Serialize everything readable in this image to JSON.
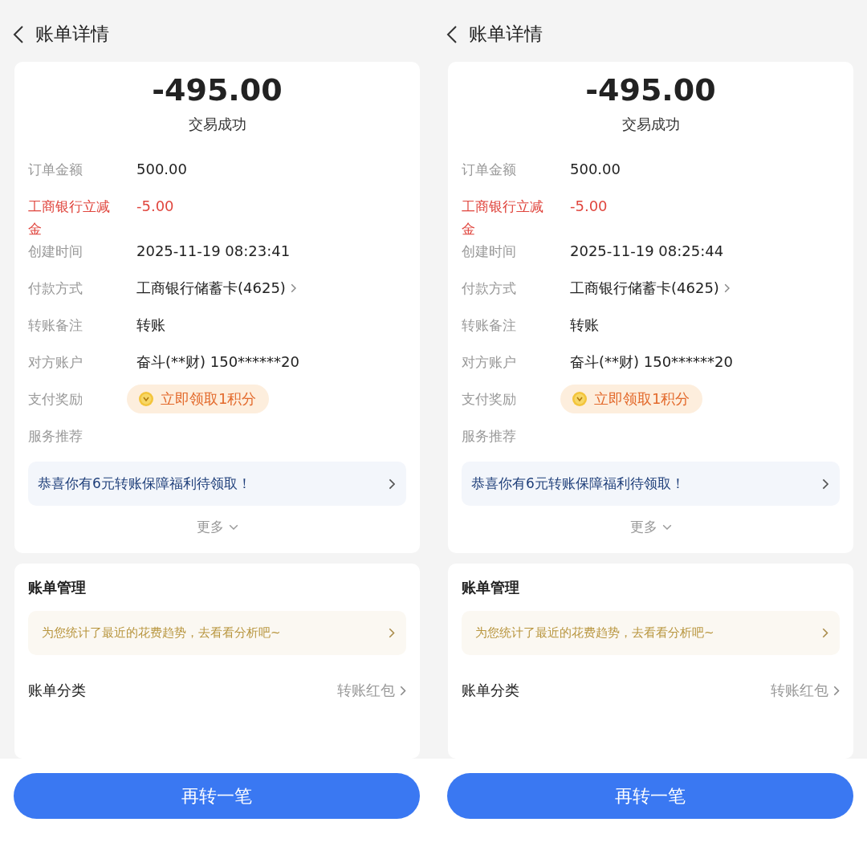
{
  "panels": [
    {
      "header": {
        "title": "账单详情"
      },
      "amount": "-495.00",
      "status": "交易成功",
      "rows": [
        {
          "kind": "plain",
          "label": "订单金额",
          "value": "500.00"
        },
        {
          "kind": "discount",
          "label": "工商银行立减金",
          "value": "-5.00"
        },
        {
          "kind": "plain",
          "label": "创建时间",
          "value": "2025-11-19 08:23:41"
        },
        {
          "kind": "link",
          "label": "付款方式",
          "value": "工商银行储蓄卡(4625)"
        },
        {
          "kind": "plain",
          "label": "转账备注",
          "value": "转账"
        },
        {
          "kind": "plain",
          "label": "对方账户",
          "value": "奋斗(**财) 150******20"
        },
        {
          "kind": "badge",
          "label": "支付奖励",
          "value": "立即领取1积分"
        }
      ],
      "service": {
        "label": "服务推荐",
        "banner": "恭喜你有6元转账保障福利待领取！",
        "more": "更多"
      },
      "management": {
        "title": "账单管理",
        "tip": "为您统计了最近的花费趋势，去看看分析吧~",
        "category_label": "账单分类",
        "category_value": "转账红包"
      },
      "action": "再转一笔"
    },
    {
      "header": {
        "title": "账单详情"
      },
      "amount": "-495.00",
      "status": "交易成功",
      "rows": [
        {
          "kind": "plain",
          "label": "订单金额",
          "value": "500.00"
        },
        {
          "kind": "discount",
          "label": "工商银行立减金",
          "value": "-5.00"
        },
        {
          "kind": "plain",
          "label": "创建时间",
          "value": "2025-11-19 08:25:44"
        },
        {
          "kind": "link",
          "label": "付款方式",
          "value": "工商银行储蓄卡(4625)"
        },
        {
          "kind": "plain",
          "label": "转账备注",
          "value": "转账"
        },
        {
          "kind": "plain",
          "label": "对方账户",
          "value": "奋斗(**财) 150******20"
        },
        {
          "kind": "badge",
          "label": "支付奖励",
          "value": "立即领取1积分"
        }
      ],
      "service": {
        "label": "服务推荐",
        "banner": "恭喜你有6元转账保障福利待领取！",
        "more": "更多"
      },
      "management": {
        "title": "账单管理",
        "tip": "为您统计了最近的花费趋势，去看看分析吧~",
        "category_label": "账单分类",
        "category_value": "转账红包"
      },
      "action": "再转一笔"
    }
  ]
}
